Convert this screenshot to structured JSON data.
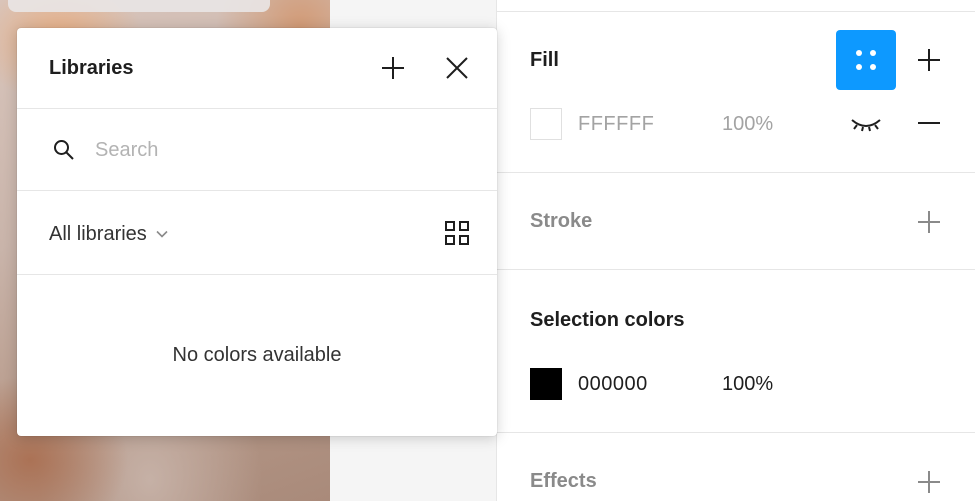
{
  "libraries_popover": {
    "title": "Libraries",
    "search_placeholder": "Search",
    "library_filter": "All libraries",
    "empty_message": "No colors available"
  },
  "properties_panel": {
    "fill": {
      "title": "Fill",
      "hex": "FFFFFF",
      "opacity": "100%",
      "swatch_color": "#ffffff"
    },
    "stroke": {
      "title": "Stroke"
    },
    "selection_colors": {
      "title": "Selection colors",
      "hex": "000000",
      "opacity": "100%",
      "swatch_color": "#000000"
    },
    "effects": {
      "title": "Effects"
    }
  },
  "colors": {
    "accent": "#0d99ff"
  }
}
